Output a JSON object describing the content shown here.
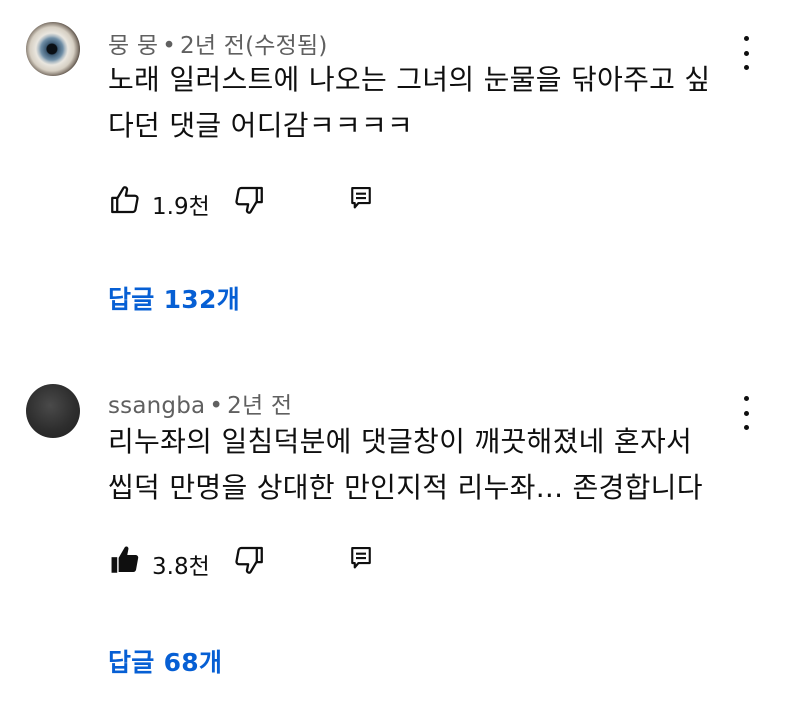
{
  "comments": [
    {
      "author": "뭉 뭉",
      "time": "2년 전(수정됨)",
      "text_lines": [
        "노래 일러스트에 나오는 그녀의 눈물을 닦아주고 싶",
        "다던 댓글 어디감ㅋㅋㅋㅋ"
      ],
      "likes": "1.9천",
      "liked": false,
      "replies_label": "답글 132개",
      "avatar_icon": "eye-avatar"
    },
    {
      "author": "ssangba",
      "time": "2년 전",
      "text_lines": [
        "리누좌의 일침덕분에 댓글창이 깨끗해졌네 혼자서",
        "씹덕 만명을 상대한 만인지적 리누좌... 존경합니다"
      ],
      "likes": "3.8천",
      "liked": true,
      "replies_label": "답글 68개",
      "avatar_icon": "dark-avatar"
    }
  ],
  "separator": "•",
  "colors": {
    "link_blue": "#065fd4",
    "meta_gray": "#606060",
    "text": "#0f0f0f"
  }
}
